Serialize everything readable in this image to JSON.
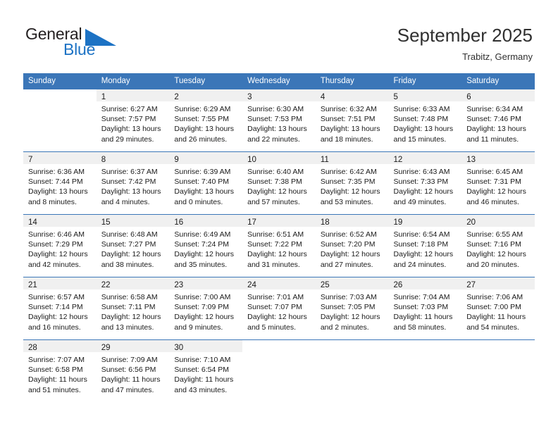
{
  "brand": {
    "name_part1": "General",
    "name_part2": "Blue",
    "triangle_color": "#1c72c4",
    "text_color": "#231f20"
  },
  "header": {
    "title": "September 2025",
    "location": "Trabitz, Germany"
  },
  "theme": {
    "header_bg": "#3b76b8",
    "header_text": "#ffffff",
    "daynum_bg": "#f0f0f0",
    "divider": "#3b76b8",
    "body_text": "#1a1a1a"
  },
  "weekdays": [
    "Sunday",
    "Monday",
    "Tuesday",
    "Wednesday",
    "Thursday",
    "Friday",
    "Saturday"
  ],
  "weeks": [
    [
      {
        "day": "",
        "lines": []
      },
      {
        "day": "1",
        "lines": [
          "Sunrise: 6:27 AM",
          "Sunset: 7:57 PM",
          "Daylight: 13 hours",
          "and 29 minutes."
        ]
      },
      {
        "day": "2",
        "lines": [
          "Sunrise: 6:29 AM",
          "Sunset: 7:55 PM",
          "Daylight: 13 hours",
          "and 26 minutes."
        ]
      },
      {
        "day": "3",
        "lines": [
          "Sunrise: 6:30 AM",
          "Sunset: 7:53 PM",
          "Daylight: 13 hours",
          "and 22 minutes."
        ]
      },
      {
        "day": "4",
        "lines": [
          "Sunrise: 6:32 AM",
          "Sunset: 7:51 PM",
          "Daylight: 13 hours",
          "and 18 minutes."
        ]
      },
      {
        "day": "5",
        "lines": [
          "Sunrise: 6:33 AM",
          "Sunset: 7:48 PM",
          "Daylight: 13 hours",
          "and 15 minutes."
        ]
      },
      {
        "day": "6",
        "lines": [
          "Sunrise: 6:34 AM",
          "Sunset: 7:46 PM",
          "Daylight: 13 hours",
          "and 11 minutes."
        ]
      }
    ],
    [
      {
        "day": "7",
        "lines": [
          "Sunrise: 6:36 AM",
          "Sunset: 7:44 PM",
          "Daylight: 13 hours",
          "and 8 minutes."
        ]
      },
      {
        "day": "8",
        "lines": [
          "Sunrise: 6:37 AM",
          "Sunset: 7:42 PM",
          "Daylight: 13 hours",
          "and 4 minutes."
        ]
      },
      {
        "day": "9",
        "lines": [
          "Sunrise: 6:39 AM",
          "Sunset: 7:40 PM",
          "Daylight: 13 hours",
          "and 0 minutes."
        ]
      },
      {
        "day": "10",
        "lines": [
          "Sunrise: 6:40 AM",
          "Sunset: 7:38 PM",
          "Daylight: 12 hours",
          "and 57 minutes."
        ]
      },
      {
        "day": "11",
        "lines": [
          "Sunrise: 6:42 AM",
          "Sunset: 7:35 PM",
          "Daylight: 12 hours",
          "and 53 minutes."
        ]
      },
      {
        "day": "12",
        "lines": [
          "Sunrise: 6:43 AM",
          "Sunset: 7:33 PM",
          "Daylight: 12 hours",
          "and 49 minutes."
        ]
      },
      {
        "day": "13",
        "lines": [
          "Sunrise: 6:45 AM",
          "Sunset: 7:31 PM",
          "Daylight: 12 hours",
          "and 46 minutes."
        ]
      }
    ],
    [
      {
        "day": "14",
        "lines": [
          "Sunrise: 6:46 AM",
          "Sunset: 7:29 PM",
          "Daylight: 12 hours",
          "and 42 minutes."
        ]
      },
      {
        "day": "15",
        "lines": [
          "Sunrise: 6:48 AM",
          "Sunset: 7:27 PM",
          "Daylight: 12 hours",
          "and 38 minutes."
        ]
      },
      {
        "day": "16",
        "lines": [
          "Sunrise: 6:49 AM",
          "Sunset: 7:24 PM",
          "Daylight: 12 hours",
          "and 35 minutes."
        ]
      },
      {
        "day": "17",
        "lines": [
          "Sunrise: 6:51 AM",
          "Sunset: 7:22 PM",
          "Daylight: 12 hours",
          "and 31 minutes."
        ]
      },
      {
        "day": "18",
        "lines": [
          "Sunrise: 6:52 AM",
          "Sunset: 7:20 PM",
          "Daylight: 12 hours",
          "and 27 minutes."
        ]
      },
      {
        "day": "19",
        "lines": [
          "Sunrise: 6:54 AM",
          "Sunset: 7:18 PM",
          "Daylight: 12 hours",
          "and 24 minutes."
        ]
      },
      {
        "day": "20",
        "lines": [
          "Sunrise: 6:55 AM",
          "Sunset: 7:16 PM",
          "Daylight: 12 hours",
          "and 20 minutes."
        ]
      }
    ],
    [
      {
        "day": "21",
        "lines": [
          "Sunrise: 6:57 AM",
          "Sunset: 7:14 PM",
          "Daylight: 12 hours",
          "and 16 minutes."
        ]
      },
      {
        "day": "22",
        "lines": [
          "Sunrise: 6:58 AM",
          "Sunset: 7:11 PM",
          "Daylight: 12 hours",
          "and 13 minutes."
        ]
      },
      {
        "day": "23",
        "lines": [
          "Sunrise: 7:00 AM",
          "Sunset: 7:09 PM",
          "Daylight: 12 hours",
          "and 9 minutes."
        ]
      },
      {
        "day": "24",
        "lines": [
          "Sunrise: 7:01 AM",
          "Sunset: 7:07 PM",
          "Daylight: 12 hours",
          "and 5 minutes."
        ]
      },
      {
        "day": "25",
        "lines": [
          "Sunrise: 7:03 AM",
          "Sunset: 7:05 PM",
          "Daylight: 12 hours",
          "and 2 minutes."
        ]
      },
      {
        "day": "26",
        "lines": [
          "Sunrise: 7:04 AM",
          "Sunset: 7:03 PM",
          "Daylight: 11 hours",
          "and 58 minutes."
        ]
      },
      {
        "day": "27",
        "lines": [
          "Sunrise: 7:06 AM",
          "Sunset: 7:00 PM",
          "Daylight: 11 hours",
          "and 54 minutes."
        ]
      }
    ],
    [
      {
        "day": "28",
        "lines": [
          "Sunrise: 7:07 AM",
          "Sunset: 6:58 PM",
          "Daylight: 11 hours",
          "and 51 minutes."
        ]
      },
      {
        "day": "29",
        "lines": [
          "Sunrise: 7:09 AM",
          "Sunset: 6:56 PM",
          "Daylight: 11 hours",
          "and 47 minutes."
        ]
      },
      {
        "day": "30",
        "lines": [
          "Sunrise: 7:10 AM",
          "Sunset: 6:54 PM",
          "Daylight: 11 hours",
          "and 43 minutes."
        ]
      },
      {
        "day": "",
        "lines": []
      },
      {
        "day": "",
        "lines": []
      },
      {
        "day": "",
        "lines": []
      },
      {
        "day": "",
        "lines": []
      }
    ]
  ]
}
